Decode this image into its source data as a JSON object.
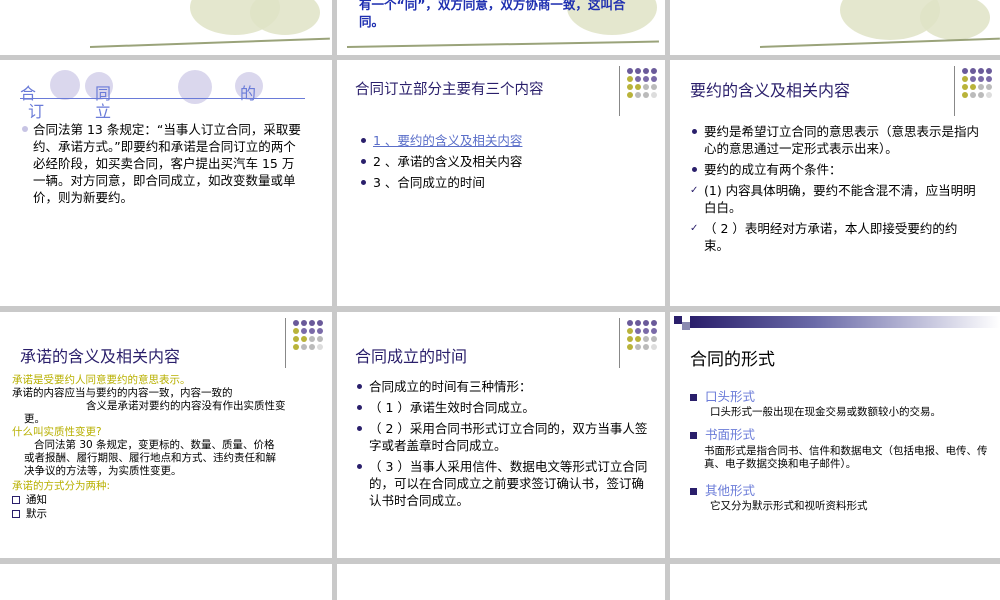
{
  "slides": {
    "top_middle": {
      "text": "有一个“同”，双方同意，双方协商一致，这叫合同。"
    },
    "s1": {
      "title_chars": [
        "合",
        "同",
        "订",
        "立",
        "的"
      ],
      "body": "合同法第 13 条规定：“当事人订立合同，采取要约、承诺方式。”即要约和承诺是合同订立的两个必经阶段，如买卖合同，客户提出买汽车 15 万一辆。对方同意，即合同成立，如改变数量或单价，则为新要约。"
    },
    "s2": {
      "title": "合同订立部分主要有三个内容",
      "items": [
        "1 、要约的含义及相关内容",
        "2 、承诺的含义及相关内容",
        "3 、合同成立的时间"
      ]
    },
    "s3": {
      "title": "要约的含义及相关内容",
      "items": [
        "要约是希望订立合同的意思表示（意思表示是指内心的意思通过一定形式表示出来）。",
        "要约的成立有两个条件：",
        "(1) 内容具体明确，要约不能含混不清，应当明明白白。",
        "（ 2 ）表明经对方承诺，本人即接受要约的约束。"
      ]
    },
    "s4": {
      "title": "承诺的含义及相关内容",
      "line1": "承诺是受要约人同意要约的意思表示。",
      "line2a": "承诺的内容应当与要约的内容一致，内容一致的",
      "line2b": "含义是承诺对要约的内容没有作出实质性变",
      "line2c": "更。",
      "q": "什么叫实质性变更?",
      "para_a": "合同法第 30 条规定，变更标的、数量、质量、价格",
      "para_b": "或者报酬、履行期限、履行地点和方式、违约责任和解",
      "para_c": "决争议的方法等，为实质性变更。",
      "ways": "承诺的方式分为两种:",
      "opt1": "通知",
      "opt2": "默示"
    },
    "s5": {
      "title": "合同成立的时间",
      "items": [
        "合同成立的时间有三种情形：",
        "（ 1 ）承诺生效时合同成立。",
        "（ 2 ）采用合同书形式订立合同的，双方当事人签字或者盖章时合同成立。",
        "（ 3 ）当事人采用信件、数据电文等形式订立合同的，可以在合同成立之前要求签订确认书，签订确认书时合同成立。"
      ]
    },
    "s6": {
      "title": "合同的形式",
      "h1": "口头形式",
      "p1": "口头形式一般出现在现金交易或数额较小的交易。",
      "h2": "书面形式",
      "p2": "书面形式是指合同书、信件和数据电文（包括电报、电传、传真、电子数据交换和电子邮件）。",
      "h3": "其他形式",
      "p3": "它又分为默示形式和视听资料形式"
    }
  },
  "colors": {
    "navy": "#2a1f6b",
    "purple": "#7a6aa8",
    "olive": "#b9b33a",
    "grey": "#c9c9c9",
    "link": "#5b6fc9"
  }
}
